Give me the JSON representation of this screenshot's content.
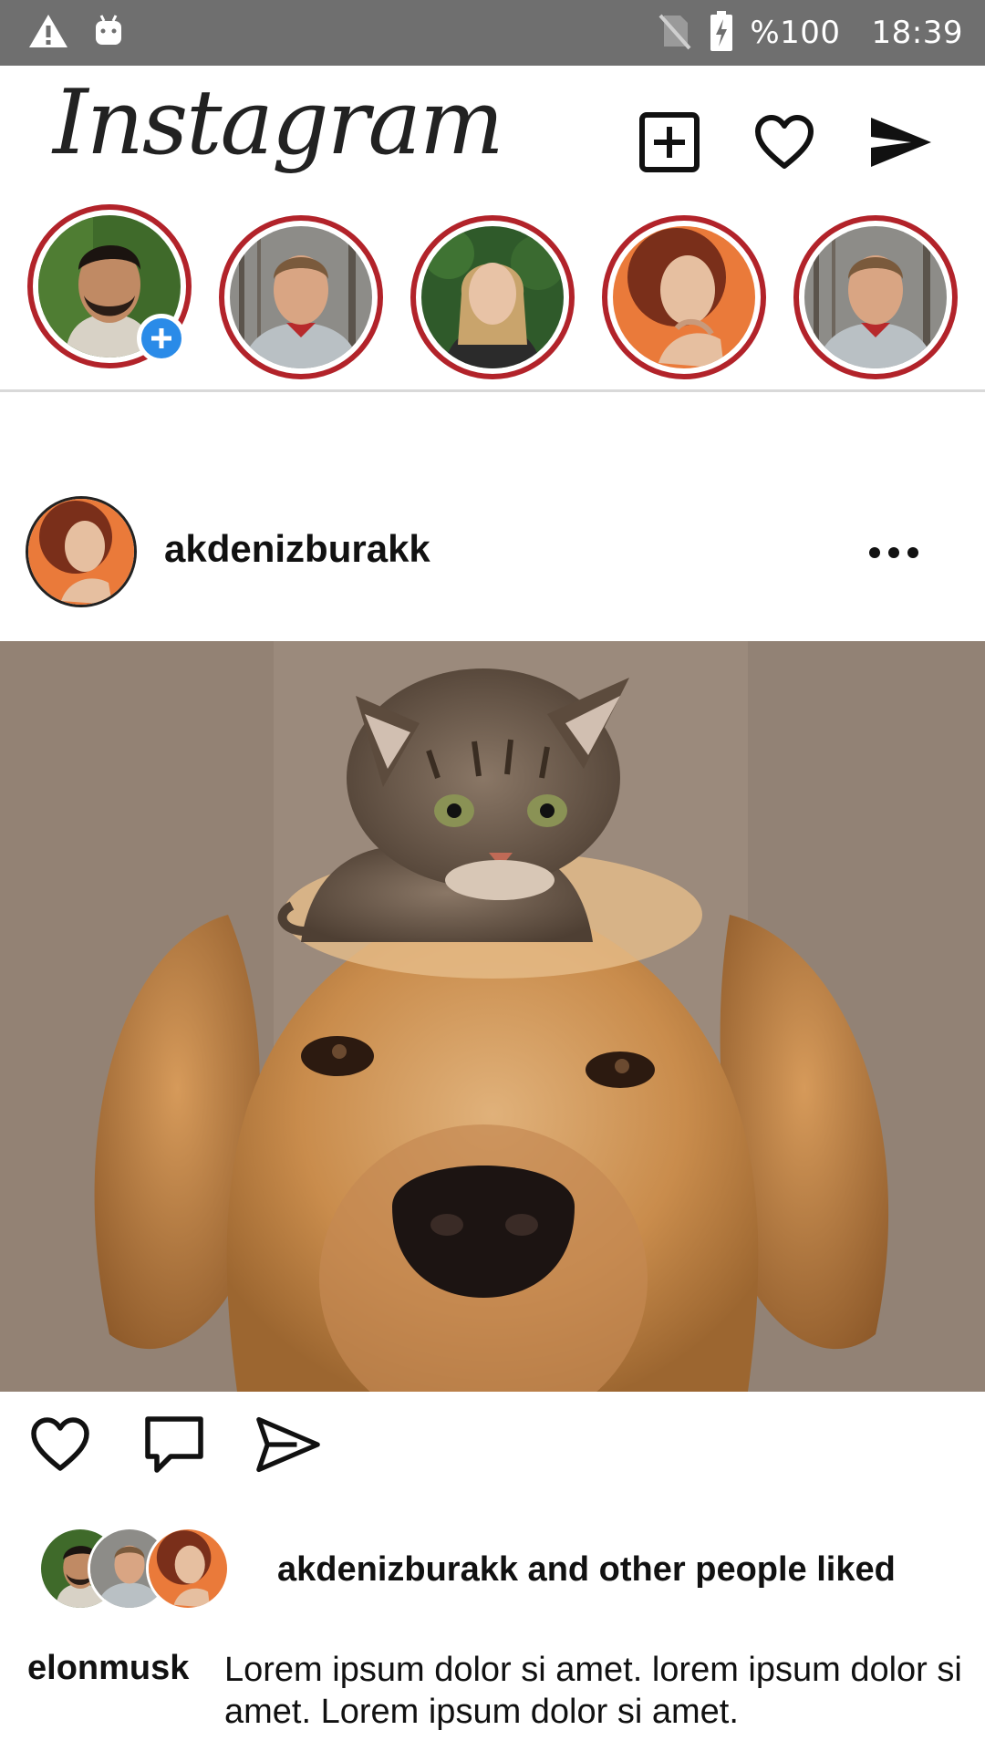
{
  "status_bar": {
    "battery": "%100",
    "time": "18:39",
    "icons": [
      "warning-icon",
      "android-icon",
      "no-sim-icon",
      "battery-charging-icon"
    ]
  },
  "header": {
    "logo": "Instagram",
    "icons": [
      "new-post-icon",
      "heart-icon",
      "send-icon"
    ]
  },
  "stories": [
    {
      "name": "own-story",
      "has_add_badge": true
    },
    {
      "name": "story-2"
    },
    {
      "name": "story-3"
    },
    {
      "name": "story-4"
    },
    {
      "name": "story-5"
    }
  ],
  "post": {
    "username": "akdenizburakk",
    "image_alt": "kitten sitting on golden retriever's head",
    "liked_text": "akdenizburakk and other people liked",
    "caption_user": "elonmusk",
    "caption_text": "Lorem ipsum dolor si amet. lorem ipsum dolor si amet. Lorem ipsum dolor si amet."
  },
  "colors": {
    "story_ring": "#b2232a",
    "status_bar": "#6f6f6f",
    "add_badge": "#2a8be8"
  }
}
